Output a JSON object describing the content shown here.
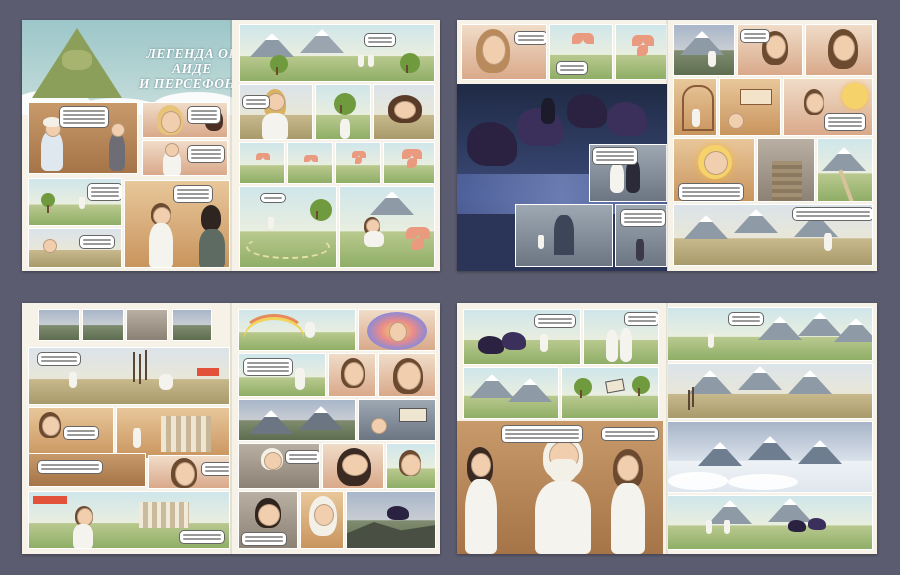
{
  "book": {
    "title_line1": "ЛЕГЕНДА ОБ АИДЕ",
    "title_line2": "И ПЕРСЕФОНЕ"
  },
  "spreads": [
    {
      "name": "spread-1",
      "description_visible": false
    },
    {
      "name": "spread-2"
    },
    {
      "name": "spread-3"
    },
    {
      "name": "spread-4"
    }
  ],
  "colors": {
    "background": "#5c5c70",
    "page": "#f6f2e8",
    "title_sky": "#9cc6c9",
    "accent_red": "#e2513a"
  }
}
